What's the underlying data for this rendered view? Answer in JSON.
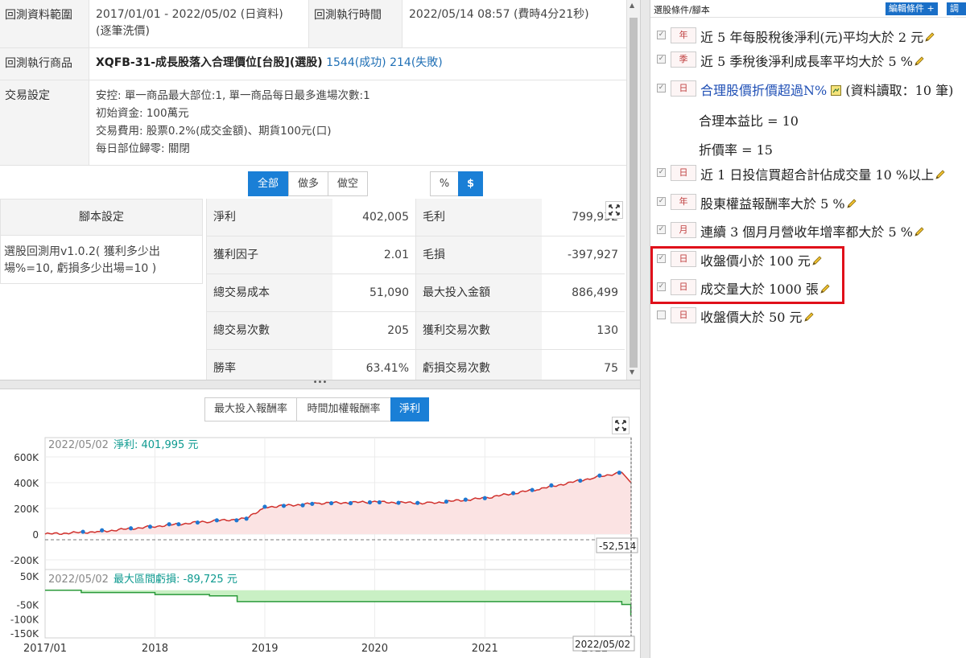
{
  "info": {
    "range_label": "回測資料範圍",
    "range_value": "2017/01/01 - 2022/05/02 (日資料)",
    "range_sub": "(逐筆洗價)",
    "time_label": "回測執行時間",
    "time_value": "2022/05/14 08:57 (費時4分21秒)",
    "product_label": "回測執行商品",
    "product_name": "XQFB-31-成長股落入合理價位[台股](選股)",
    "product_success": "1544(成功)",
    "product_fail": "214(失敗)",
    "trade_label": "交易設定",
    "trade_lines": [
      "安控: 單一商品最大部位:1, 單一商品每日最多進場次數:1",
      "初始資金: 100萬元",
      "交易費用: 股票0.2%(成交金額)、期貨100元(口)",
      "每日部位歸零: 關閉"
    ]
  },
  "filter_buttons": {
    "all": "全部",
    "long": "做多",
    "short": "做空",
    "pct": "%",
    "dollar": "$"
  },
  "script": {
    "header": "腳本設定",
    "body_line1": "選股回測用v1.0.2( 獲利多少出",
    "body_line2": "場%=10, 虧損多少出場=10 )"
  },
  "metrics": [
    {
      "l1": "淨利",
      "v1": "402,005",
      "l2": "毛利",
      "v2": "799,932"
    },
    {
      "l1": "獲利因子",
      "v1": "2.01",
      "l2": "毛損",
      "v2": "-397,927"
    },
    {
      "l1": "總交易成本",
      "v1": "51,090",
      "l2": "最大投入金額",
      "v2": "886,499"
    },
    {
      "l1": "總交易次數",
      "v1": "205",
      "l2": "獲利交易次數",
      "v2": "130"
    },
    {
      "l1": "勝率",
      "v1": "63.41%",
      "l2": "虧損交易次數",
      "v2": "75"
    }
  ],
  "chart_tabs": {
    "t1": "最大投入報酬率",
    "t2": "時間加權報酬率",
    "t3": "淨利"
  },
  "chart_data": [
    {
      "type": "area",
      "date_label": "2022/05/02",
      "title": "淨利: 401,995 元",
      "ylim": [
        -200000,
        700000
      ],
      "yticks": [
        "600K",
        "400K",
        "200K",
        "0",
        "-200K"
      ],
      "min_label": "-52,514",
      "x": [
        "2017-01",
        "2017-07",
        "2018-01",
        "2018-07",
        "2018-11",
        "2019-01",
        "2019-07",
        "2020-01",
        "2020-07",
        "2021-01",
        "2021-07",
        "2022-01",
        "2022-04",
        "2022-05"
      ],
      "series": [
        {
          "values": [
            0,
            20000,
            60000,
            100000,
            120000,
            210000,
            240000,
            250000,
            240000,
            280000,
            350000,
            440000,
            480000,
            401995
          ]
        }
      ]
    },
    {
      "type": "area",
      "date_label": "2022/05/02",
      "title": "最大區間虧損: -89,725 元",
      "ylim": [
        -150000,
        50000
      ],
      "yticks": [
        "50K",
        "-50K",
        "-100K",
        "-150K"
      ],
      "x": [
        "2017-01",
        "2017-05",
        "2018-01",
        "2018-07",
        "2018-10",
        "2021-12",
        "2022-04",
        "2022-05"
      ],
      "series": [
        {
          "values": [
            0,
            -8000,
            -15000,
            -20000,
            -40000,
            -40000,
            -50000,
            -89725
          ]
        }
      ]
    }
  ],
  "x_axis": [
    "2017/01",
    "2018",
    "2019",
    "2020",
    "2021",
    "2022"
  ],
  "x_end_label": "2022/05/02",
  "right_panel": {
    "title": "選股條件/腳本",
    "edit_button": "編輯條件 +",
    "adjust_button": "調整",
    "conditions": [
      {
        "tag": "年",
        "text": "近 5 年每股稅後淨利(元)平均大於 2 元",
        "checked": true
      },
      {
        "tag": "季",
        "text": "近 5 季稅後淨利成長率平均大於 5 %",
        "checked": true
      },
      {
        "tag": "日",
        "text": "合理股價折價超過N%",
        "extra": "(資料讀取：10 筆)",
        "checked": true,
        "link": true
      },
      {
        "tag": "日",
        "text": "近 1 日投信買超合計佔成交量 10 %以上",
        "checked": true
      },
      {
        "tag": "年",
        "text": "股東權益報酬率大於 5 %",
        "checked": true
      },
      {
        "tag": "月",
        "text": "連續 3 個月月營收年增率都大於 5 %",
        "checked": true
      },
      {
        "tag": "日",
        "text": "收盤價小於 100 元",
        "checked": true
      },
      {
        "tag": "日",
        "text": "成交量大於 1000 張",
        "checked": true
      },
      {
        "tag": "日",
        "text": "收盤價大於 50 元",
        "checked": false
      }
    ],
    "params": [
      "合理本益比 = 10",
      "折價率 = 15"
    ]
  },
  "colors": {
    "accent": "#1a7fd6",
    "highlight": "#e0101a",
    "profit_line": "#d0312d",
    "dd_fill": "#c9f0c4",
    "dd_line": "#2a9a3a"
  }
}
